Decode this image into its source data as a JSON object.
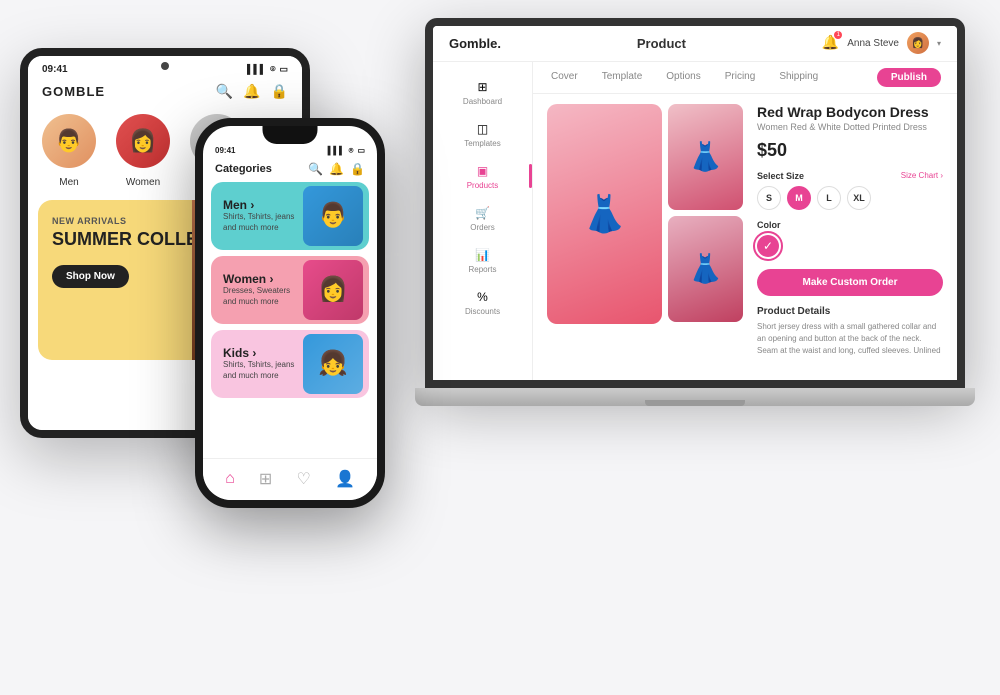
{
  "scene": {
    "background": "#f5f5f7"
  },
  "tablet": {
    "status": {
      "time": "09:41",
      "icons": [
        "signal",
        "wifi",
        "battery"
      ]
    },
    "logo": "GOMBLE",
    "categories": [
      {
        "id": "men",
        "label": "Men",
        "emoji": "👨"
      },
      {
        "id": "women",
        "label": "Women",
        "emoji": "👩"
      },
      {
        "id": "other",
        "label": "",
        "emoji": "👱"
      }
    ],
    "banner": {
      "tag": "NEW ARRIVALS",
      "title": "SUMMER COLLECTION",
      "button": "Shop Now"
    }
  },
  "phone": {
    "status_time": "09:41",
    "header_title": "Categories",
    "categories": [
      {
        "id": "men",
        "name": "Men ›",
        "sub": "Shirts, Tshirts, jeans and much more",
        "color": "#5ecfcf",
        "emoji": "👨"
      },
      {
        "id": "women",
        "name": "Women ›",
        "sub": "Dresses, Sweaters and much more",
        "color": "#f5a0b0",
        "emoji": "👩"
      },
      {
        "id": "kids",
        "name": "Kids ›",
        "sub": "Shirts, Tshirts, jeans and much more",
        "color": "#f9c5e0",
        "emoji": "👧"
      }
    ],
    "nav_items": [
      "home",
      "grid",
      "heart",
      "person"
    ]
  },
  "laptop": {
    "topbar": {
      "logo": "Gomble.",
      "title": "Product",
      "user_name": "Anna Steve",
      "notif": "🔔"
    },
    "sidebar": {
      "items": [
        {
          "id": "dashboard",
          "label": "Dashboard",
          "icon": "⊞"
        },
        {
          "id": "templates",
          "label": "Templates",
          "icon": "◫"
        },
        {
          "id": "products",
          "label": "Products",
          "icon": "▣",
          "active": true
        },
        {
          "id": "orders",
          "label": "Orders",
          "icon": "🛒"
        },
        {
          "id": "reports",
          "label": "Reports",
          "icon": "📊"
        },
        {
          "id": "discounts",
          "label": "Discounts",
          "icon": "%"
        }
      ]
    },
    "tabs": [
      {
        "id": "cover",
        "label": "Cover",
        "active": false
      },
      {
        "id": "template",
        "label": "Template",
        "active": false
      },
      {
        "id": "options",
        "label": "Options",
        "active": false
      },
      {
        "id": "pricing",
        "label": "Pricing",
        "active": false
      },
      {
        "id": "shipping",
        "label": "Shipping",
        "active": false
      }
    ],
    "publish_btn": "Publish",
    "product": {
      "name": "Red Wrap Bodycon Dress",
      "sub_name": "Women Red & White Dotted Printed Dress",
      "price": "$50",
      "select_size_label": "Select Size",
      "size_chart_label": "Size Chart ›",
      "sizes": [
        "S",
        "M",
        "L",
        "XL"
      ],
      "selected_size": "M",
      "color_label": "Color",
      "colors": [
        "#e84393"
      ],
      "custom_order_btn": "Make Custom Order",
      "details_title": "Product Details",
      "details_text": "Short jersey dress with a small gathered collar and an opening and button at the back of the neck. Seam at the waist and long, cuffed sleeves. Unlined"
    }
  }
}
